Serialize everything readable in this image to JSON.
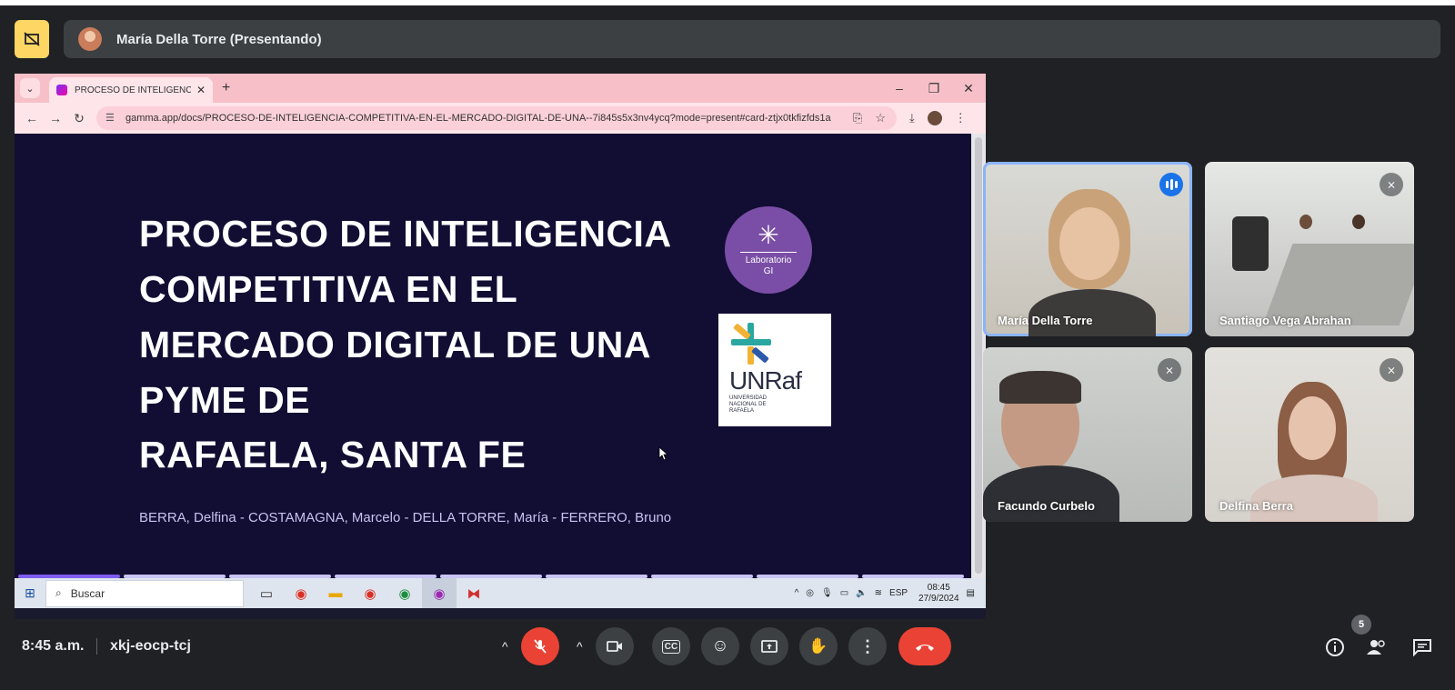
{
  "presenter": {
    "name": "María Della Torre (Presentando)"
  },
  "browser": {
    "tab_title": "PROCESO DE INTELIGENCIA CO",
    "url": "gamma.app/docs/PROCESO-DE-INTELIGENCIA-COMPETITIVA-EN-EL-MERCADO-DIGITAL-DE-UNA--7i845s5x3nv4ycq?mode=present#card-ztjx0tkfizfds1a"
  },
  "slide": {
    "title_lines": [
      "PROCESO DE INTELIGENCIA",
      "COMPETITIVA EN EL",
      "MERCADO DIGITAL DE UNA",
      "PYME DE"
    ],
    "title_last": "RAFAELA, SANTA FE",
    "authors": "BERRA, Delfina - COSTAMAGNA, Marcelo - DELLA TORRE, María - FERRERO, Bruno",
    "lab_logo_line1": "Laboratorio",
    "lab_logo_line2": "GI",
    "unraf_name": "UNRaf",
    "unraf_sub1": "UNIVERSIDAD",
    "unraf_sub2": "NACIONAL DE",
    "unraf_sub3": "RAFAELA"
  },
  "taskbar": {
    "search_placeholder": "Buscar",
    "lang": "ESP",
    "clock_time": "08:45",
    "clock_date": "27/9/2024"
  },
  "participants": [
    {
      "name": "María Della Torre",
      "status": "speaking"
    },
    {
      "name": "Santiago Vega Abrahan",
      "status": "muted"
    },
    {
      "name": "Facundo Curbelo",
      "status": "muted"
    },
    {
      "name": "Delfina Berra",
      "status": "muted"
    }
  ],
  "meeting": {
    "time": "8:45 a.m.",
    "code": "xkj-eocp-tcj",
    "participants_count": "5"
  },
  "colors": {
    "meet_bg": "#202124",
    "control_bg": "#3c4043",
    "end_call": "#ea4335",
    "slide_bg": "#120d33",
    "browser_pink": "#f7c0c8",
    "present_yellow": "#fdd663"
  }
}
